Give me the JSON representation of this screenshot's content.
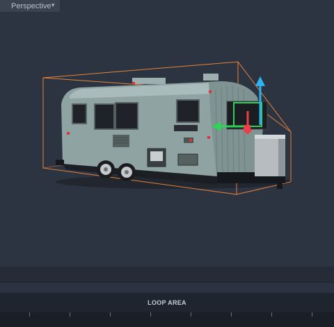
{
  "viewport": {
    "view_mode_label": "Perspective",
    "dropdown_icon": "caret-down-icon"
  },
  "object": {
    "name": "airstream-trailer-voxel",
    "bbox_color": "#e8833a",
    "gizmo": {
      "y_axis_color": "#2fb2f0",
      "x_axis_color": "#2fd35a",
      "z_axis_color": "#e8414a"
    }
  },
  "timeline": {
    "loop_area_label": "LOOP AREA"
  }
}
